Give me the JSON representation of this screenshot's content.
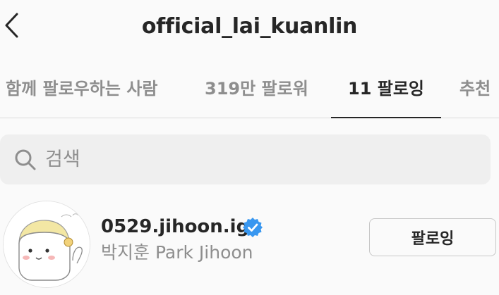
{
  "header": {
    "title": "official_lai_kuanlin",
    "back_icon": "chevron-left-icon"
  },
  "tabs": [
    {
      "label": "함께 팔로우하는 사람",
      "active": false
    },
    {
      "label": "319만 팔로워",
      "active": false
    },
    {
      "label": "11 팔로잉",
      "active": true
    },
    {
      "label": "추천",
      "active": false
    }
  ],
  "search": {
    "placeholder": "검색",
    "value": "",
    "icon": "search-icon"
  },
  "users": [
    {
      "username": "0529.jihoon.ig",
      "verified": true,
      "full_name": "박지훈 Park Jihoon",
      "follow_button_label": "팔로잉",
      "avatar_icon": "avatar-illustration"
    }
  ],
  "colors": {
    "background": "#fafafa",
    "primary_text": "#262626",
    "secondary_text": "#8e8e8e",
    "verified_blue": "#3897f0",
    "search_bg": "#efefef",
    "divider": "#dbdbdb"
  }
}
